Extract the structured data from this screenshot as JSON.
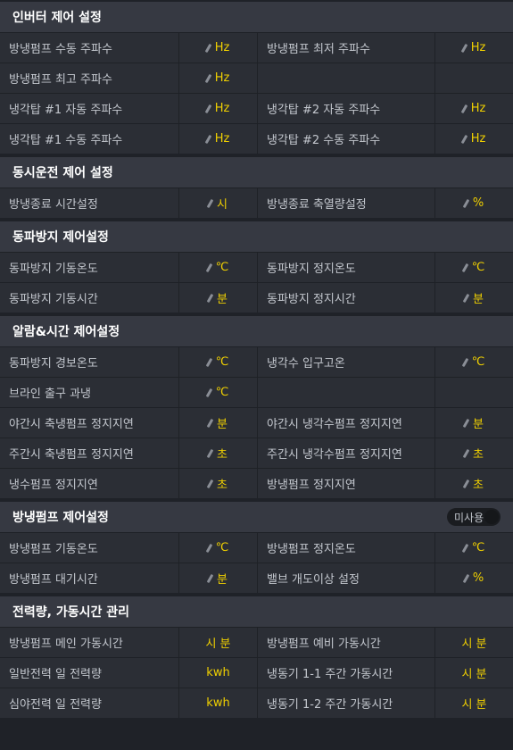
{
  "sections": [
    {
      "title": "인버터 제어 설정",
      "rows": [
        [
          {
            "label": "방냉펌프 수동 주파수",
            "unit": "Hz",
            "edit": true
          },
          {
            "label": "방냉펌프 최저 주파수",
            "unit": "Hz",
            "edit": true
          }
        ],
        [
          {
            "label": "방냉펌프 최고 주파수",
            "unit": "Hz",
            "edit": true
          },
          null
        ],
        [
          {
            "label": "냉각탑 #1 자동 주파수",
            "unit": "Hz",
            "edit": true
          },
          {
            "label": "냉각탑 #2 자동 주파수",
            "unit": "Hz",
            "edit": true
          }
        ],
        [
          {
            "label": "냉각탑 #1 수동 주파수",
            "unit": "Hz",
            "edit": true
          },
          {
            "label": "냉각탑 #2 수동 주파수",
            "unit": "Hz",
            "edit": true
          }
        ]
      ]
    },
    {
      "title": "동시운전 제어 설정",
      "rows": [
        [
          {
            "label": "방냉종료 시간설정",
            "unit": "시",
            "edit": true
          },
          {
            "label": "방냉종료 축열량설정",
            "unit": "%",
            "edit": true
          }
        ]
      ]
    },
    {
      "title": "동파방지 제어설정",
      "rows": [
        [
          {
            "label": "동파방지 기동온도",
            "unit": "℃",
            "edit": true
          },
          {
            "label": "동파방지 정지온도",
            "unit": "℃",
            "edit": true
          }
        ],
        [
          {
            "label": "동파방지 기동시간",
            "unit": "분",
            "edit": true
          },
          {
            "label": "동파방지 정지시간",
            "unit": "분",
            "edit": true
          }
        ]
      ]
    },
    {
      "title": "알람&시간 제어설정",
      "rows": [
        [
          {
            "label": "동파방지 경보온도",
            "unit": "℃",
            "edit": true
          },
          {
            "label": "냉각수 입구고온",
            "unit": "℃",
            "edit": true
          }
        ],
        [
          {
            "label": "브라인 출구 과냉",
            "unit": "℃",
            "edit": true
          },
          null
        ],
        [
          {
            "label": "야간시 축냉펌프 정지지연",
            "unit": "분",
            "edit": true
          },
          {
            "label": "야간시 냉각수펌프 정지지연",
            "unit": "분",
            "edit": true
          }
        ],
        [
          {
            "label": "주간시 축냉펌프 정지지연",
            "unit": "초",
            "edit": true
          },
          {
            "label": "주간시 냉각수펌프 정지지연",
            "unit": "초",
            "edit": true
          }
        ],
        [
          {
            "label": "냉수펌프 정지지연",
            "unit": "초",
            "edit": true
          },
          {
            "label": "방냉펌프 정지지연",
            "unit": "초",
            "edit": true
          }
        ]
      ]
    },
    {
      "title": "방냉펌프 제어설정",
      "toggle": "미사용",
      "rows": [
        [
          {
            "label": "방냉펌프 기동온도",
            "unit": "℃",
            "edit": true
          },
          {
            "label": "방냉펌프 정지온도",
            "unit": "℃",
            "edit": true
          }
        ],
        [
          {
            "label": "방냉펌프 대기시간",
            "unit": "분",
            "edit": true
          },
          {
            "label": "밸브 개도이상 설정",
            "unit": "%",
            "edit": true
          }
        ]
      ]
    },
    {
      "title": "전력량, 가동시간 관리",
      "rows": [
        [
          {
            "label": "방냉펌프 메인 가동시간",
            "unit": "시 분",
            "edit": false
          },
          {
            "label": "방냉펌프 예비 가동시간",
            "unit": "시 분",
            "edit": false
          }
        ],
        [
          {
            "label": "일반전력 일 전력량",
            "unit": "kwh",
            "edit": false
          },
          {
            "label": "냉동기 1-1 주간 가동시간",
            "unit": "시 분",
            "edit": false
          }
        ],
        [
          {
            "label": "심야전력 일 전력량",
            "unit": "kwh",
            "edit": false
          },
          {
            "label": "냉동기 1-2 주간 가동시간",
            "unit": "시 분",
            "edit": false
          }
        ]
      ]
    }
  ]
}
